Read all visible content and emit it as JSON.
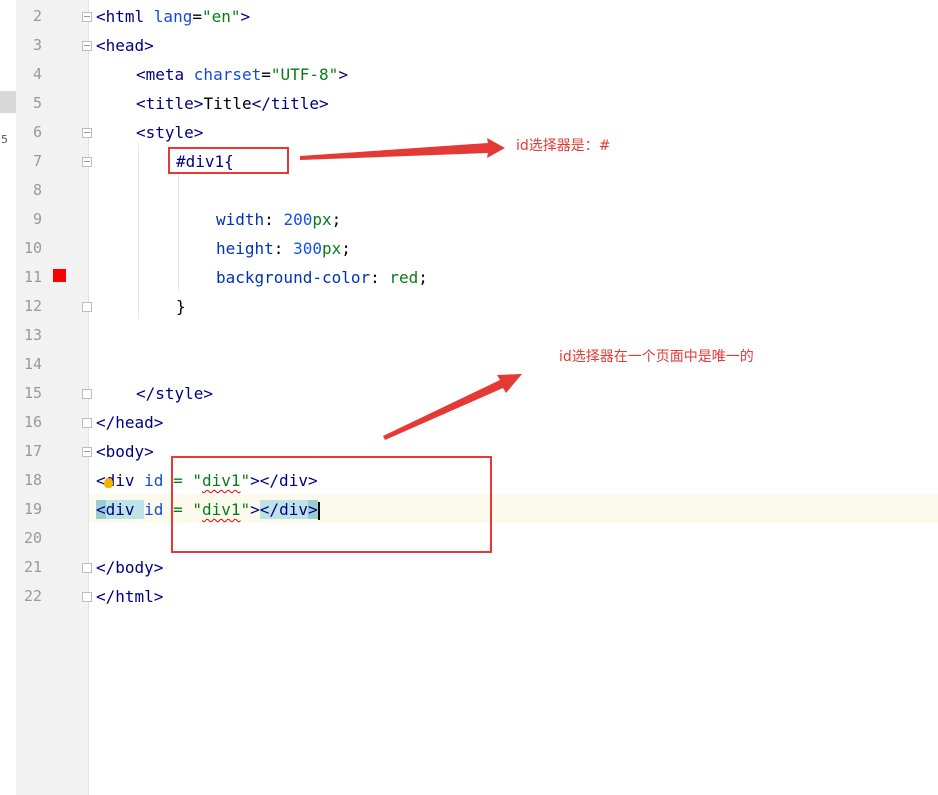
{
  "gutter": {
    "left_strip_number": "5"
  },
  "lines": [
    {
      "n": "2"
    },
    {
      "n": "3"
    },
    {
      "n": "4"
    },
    {
      "n": "5"
    },
    {
      "n": "6"
    },
    {
      "n": "7"
    },
    {
      "n": "8"
    },
    {
      "n": "9"
    },
    {
      "n": "10"
    },
    {
      "n": "11"
    },
    {
      "n": "12"
    },
    {
      "n": "13"
    },
    {
      "n": "14"
    },
    {
      "n": "15"
    },
    {
      "n": "16"
    },
    {
      "n": "17"
    },
    {
      "n": "18"
    },
    {
      "n": "19"
    },
    {
      "n": "20"
    },
    {
      "n": "21"
    },
    {
      "n": "22"
    }
  ],
  "code": {
    "l2_open": "<html ",
    "l2_attr": "lang",
    "l2_eq": "=",
    "l2_str": "\"en\"",
    "l2_close": ">",
    "l3": "<head>",
    "l4_open": "<meta ",
    "l4_attr": "charset",
    "l4_eq": "=",
    "l4_str": "\"UTF-8\"",
    "l4_close": ">",
    "l5_open": "<title>",
    "l5_text": "Title",
    "l5_close": "</title>",
    "l6": "<style>",
    "l7": "#div1{",
    "l9_prop": "width",
    "l9_colon": ": ",
    "l9_num": "200",
    "l9_unit": "px",
    "l9_semi": ";",
    "l10_prop": "height",
    "l10_colon": ": ",
    "l10_num": "300",
    "l10_unit": "px",
    "l10_semi": ";",
    "l11_prop": "background-color",
    "l11_colon": ": ",
    "l11_val": "red",
    "l11_semi": ";",
    "l12": "}",
    "l15": "</style>",
    "l16": "</head>",
    "l17": "<body>",
    "l18_lt": "<",
    "l18_tag": "div ",
    "l18_attr": "id",
    "l18_eq": " = ",
    "l18_q1": "\"",
    "l18_val": "div1",
    "l18_q2": "\"",
    "l18_close": "></div>",
    "l19_lt": "<",
    "l19_tag": "div ",
    "l19_attr": "id",
    "l19_eq": " = ",
    "l19_q1": "\"",
    "l19_val": "div1",
    "l19_q2": "\"",
    "l19_mid": ">",
    "l19_end_open": "</div",
    "l19_end_gt": ">",
    "l21": "</body>",
    "l22": "</html>"
  },
  "annotations": {
    "note1": "id选择器是：#",
    "note2": "id选择器在一个页面中是唯一的"
  },
  "colors": {
    "annotation_red": "#e53935",
    "breakpoint": "#ff0000",
    "current_line": "#fcfaed"
  }
}
